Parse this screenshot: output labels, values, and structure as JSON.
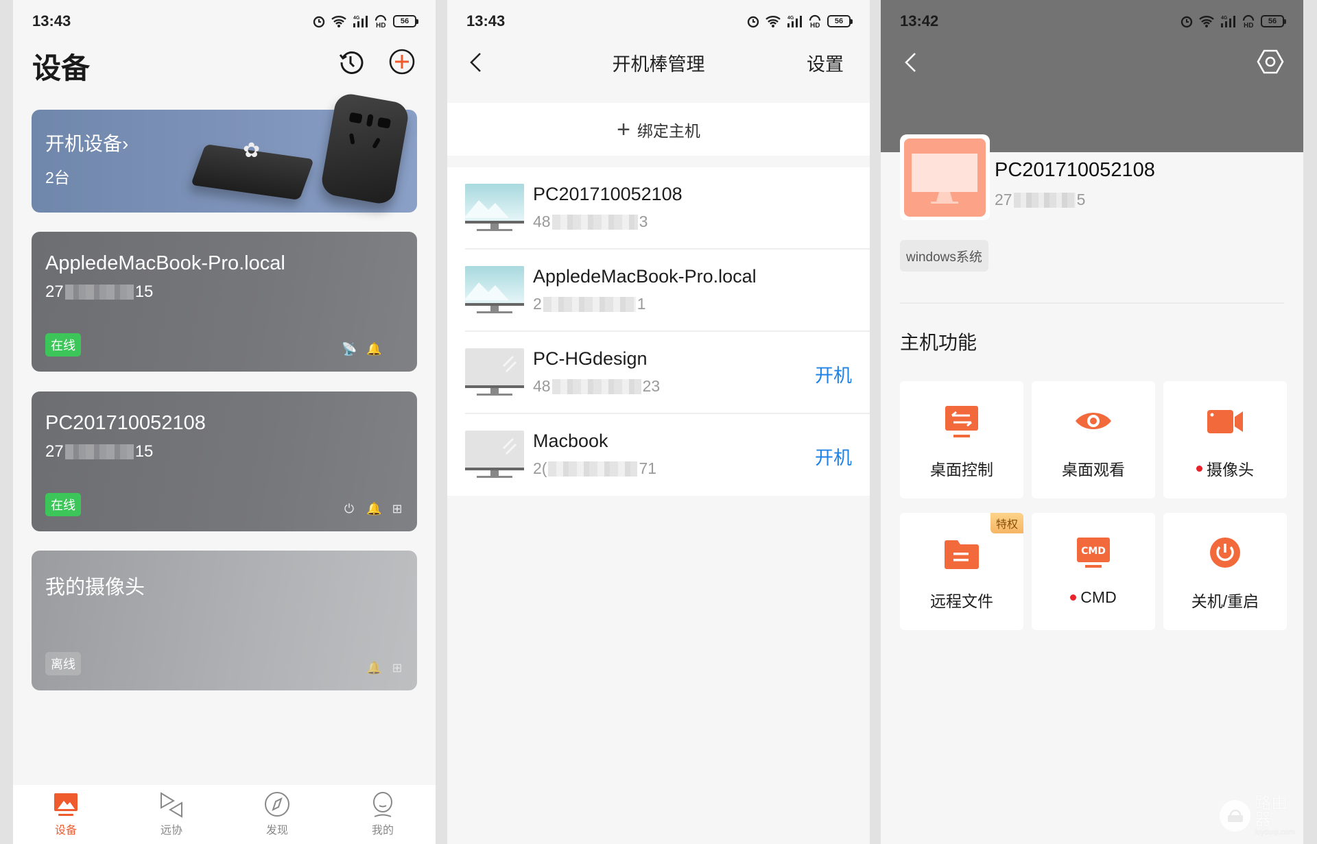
{
  "colors": {
    "accent": "#f05b2d",
    "online": "#3cc65a",
    "link_blue": "#1e82e6",
    "banner": "#7e93b9",
    "card_dark": "#76777b",
    "header_gray": "#737373",
    "avatar_salmon": "#fca287"
  },
  "status_bar": {
    "battery": "56",
    "network": "4G",
    "hd": "HD"
  },
  "panel1": {
    "time": "13:43",
    "title": "设备",
    "icons": [
      "history-icon",
      "add-circle-icon"
    ],
    "banner": {
      "title": "开机设备",
      "chevron": "›",
      "count": "2台"
    },
    "devices": [
      {
        "name": "AppledeMacBook-Pro.local",
        "id_prefix": "27",
        "id_suffix": "15",
        "status": "在线",
        "icons": [
          "satellite-icon",
          "bell-icon",
          "apple-icon"
        ]
      },
      {
        "name": "PC201710052108",
        "id_prefix": "27",
        "id_suffix": "15",
        "status": "在线",
        "icons": [
          "power-icon",
          "bell-icon",
          "windows-icon"
        ]
      },
      {
        "name": "我的摄像头",
        "status": "离线",
        "icons": [
          "bell-icon",
          "windows-icon"
        ]
      }
    ],
    "nav": [
      {
        "label": "设备",
        "icon": "devices-icon",
        "active": true
      },
      {
        "label": "远协",
        "icon": "remote-assist-icon",
        "active": false
      },
      {
        "label": "发现",
        "icon": "compass-icon",
        "active": false
      },
      {
        "label": "我的",
        "icon": "profile-icon",
        "active": false
      }
    ]
  },
  "panel2": {
    "time": "13:43",
    "title": "开机棒管理",
    "settings": "设置",
    "bind": {
      "plus": "+",
      "label": "绑定主机"
    },
    "hosts": [
      {
        "name": "PC201710052108",
        "id_prefix": "48",
        "id_suffix": "3",
        "online": true,
        "action": ""
      },
      {
        "name": "AppledeMacBook-Pro.local",
        "id_prefix": "2",
        "id_suffix": "1",
        "online": true,
        "action": ""
      },
      {
        "name": "PC-HGdesign",
        "id_prefix": "48",
        "id_suffix": "23",
        "online": false,
        "action": "开机"
      },
      {
        "name": "Macbook",
        "id_prefix": "2(",
        "id_suffix": "71",
        "online": false,
        "action": "开机"
      }
    ]
  },
  "panel3": {
    "time": "13:42",
    "host_name": "PC201710052108",
    "id_prefix": "27",
    "id_suffix": "5",
    "os_tag": "windows系统",
    "section_title": "主机功能",
    "functions": [
      {
        "label": "桌面控制",
        "icon": "desktop-control-icon",
        "dot": false,
        "badge": ""
      },
      {
        "label": "桌面观看",
        "icon": "eye-icon",
        "dot": false,
        "badge": ""
      },
      {
        "label": "摄像头",
        "icon": "video-camera-icon",
        "dot": true,
        "badge": ""
      },
      {
        "label": "远程文件",
        "icon": "folder-icon",
        "dot": false,
        "badge": "特权"
      },
      {
        "label": "CMD",
        "icon": "cmd-icon",
        "dot": true,
        "badge": "",
        "icon_text": "CMD"
      },
      {
        "label": "关机/重启",
        "icon": "power-icon",
        "dot": false,
        "badge": ""
      }
    ],
    "watermark": {
      "title": "路由器",
      "url": "luyouqi.com"
    }
  }
}
